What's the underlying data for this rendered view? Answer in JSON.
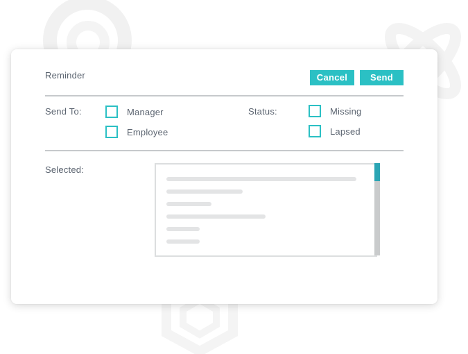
{
  "dialog": {
    "title": "Reminder",
    "cancel_label": "Cancel",
    "send_label": "Send"
  },
  "send_to": {
    "label": "Send To:",
    "options": [
      {
        "label": "Manager",
        "checked": false
      },
      {
        "label": "Employee",
        "checked": false
      }
    ]
  },
  "status": {
    "label": "Status:",
    "options": [
      {
        "label": "Missing",
        "checked": false
      },
      {
        "label": "Lapsed",
        "checked": false
      }
    ]
  },
  "selected": {
    "label": "Selected:"
  },
  "colors": {
    "accent": "#2bc0c4",
    "scroll_thumb": "#2ba5b4",
    "text": "#5b6470",
    "divider": "#c6c9cc"
  },
  "icons": {
    "background": [
      "ring-decoration-icon",
      "atom-decoration-icon",
      "hexagon-decoration-icon"
    ]
  }
}
